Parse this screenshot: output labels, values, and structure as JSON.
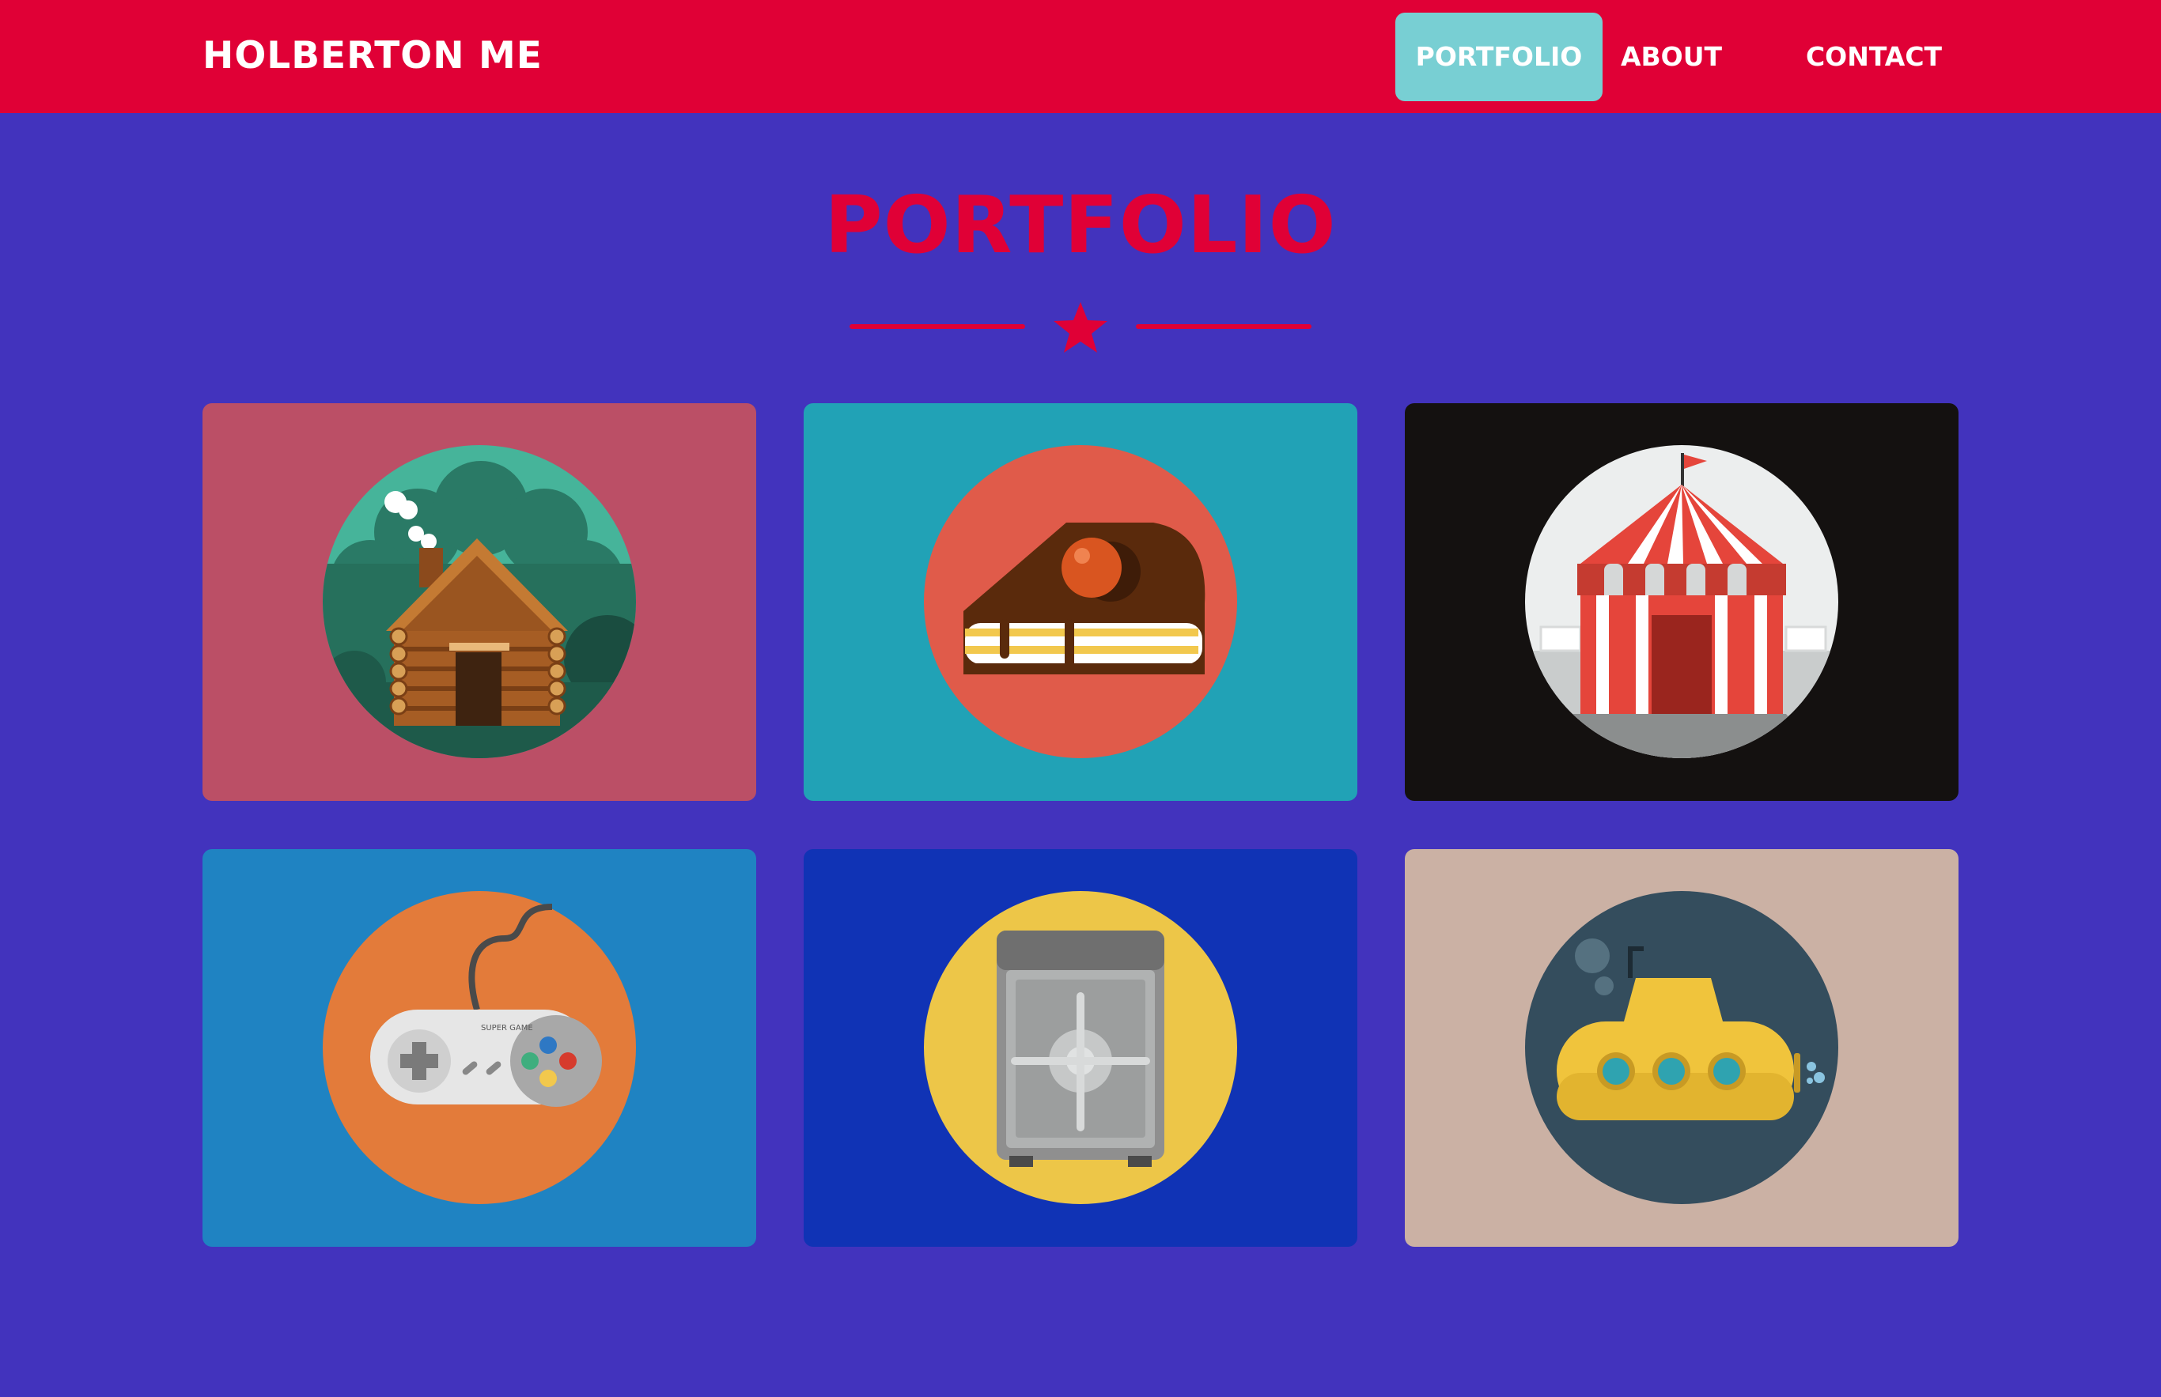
{
  "brand": "HOLBERTON ME",
  "nav": {
    "items": [
      {
        "label": "PORTFOLIO",
        "active": true
      },
      {
        "label": "ABOUT",
        "active": false
      },
      {
        "label": "CONTACT",
        "active": false
      }
    ]
  },
  "section": {
    "title": "PORTFOLIO",
    "divider_icon": "star-icon"
  },
  "portfolio": {
    "items": [
      {
        "icon": "log-cabin-icon",
        "bg": "#bb4f66",
        "circle": "#46b49a"
      },
      {
        "icon": "cake-slice-icon",
        "bg": "#21a2b6",
        "circle": "#e05b4a"
      },
      {
        "icon": "circus-tent-icon",
        "bg": "#141110",
        "circle": "#eceeee"
      },
      {
        "icon": "game-controller-icon",
        "bg": "#1f83c2",
        "circle": "#e37b3a",
        "text": "SUPER GAME"
      },
      {
        "icon": "safe-icon",
        "bg": "#1033b5",
        "circle": "#edc648"
      },
      {
        "icon": "submarine-icon",
        "bg": "#cbb1a4",
        "circle": "#344d5d"
      }
    ]
  },
  "colors": {
    "navbar": "#e00036",
    "page_bg": "#4233bd",
    "accent": "#e00036",
    "active_tab": "#78cfd3"
  }
}
